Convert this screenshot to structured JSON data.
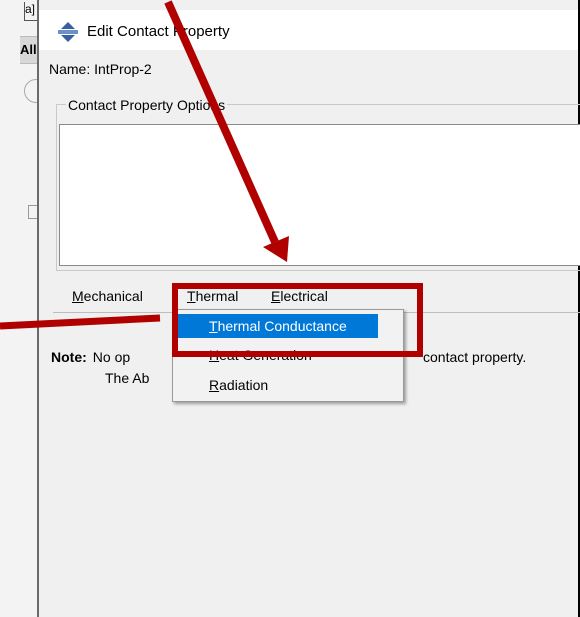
{
  "background_window": {
    "fragment_text": "a]",
    "all_label": "All"
  },
  "dialog": {
    "title": "Edit Contact Property",
    "name_label": "Name:",
    "name_value": "IntProp-2",
    "options_group_label": "Contact Property Options",
    "menubar": [
      {
        "label": "Mechanical",
        "mnemonic": "M",
        "rest": "echanical"
      },
      {
        "label": "Thermal",
        "mnemonic": "T",
        "rest": "hermal"
      },
      {
        "label": "Electrical",
        "mnemonic": "E",
        "rest": "lectrical"
      }
    ],
    "note_label": "Note:",
    "note_line1_start": "No op",
    "note_line1_end": "contact property.",
    "note_line2": "The Ab"
  },
  "dropdown": {
    "items": [
      {
        "label": "Thermal Conductance",
        "mnemonic": "T",
        "rest": "hermal Conductance",
        "highlighted": true
      },
      {
        "label": "Heat Generation",
        "mnemonic": "H",
        "rest": "eat Generation",
        "highlighted": false
      },
      {
        "label": "Radiation",
        "mnemonic": "R",
        "rest": "adiation",
        "highlighted": false
      }
    ]
  },
  "colors": {
    "annotation": "#b10000",
    "selection": "#0078d7",
    "dialog_bg": "#f0f0f0"
  }
}
